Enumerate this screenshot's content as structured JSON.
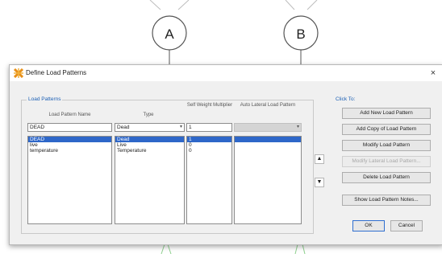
{
  "background": {
    "grid_bubbles": [
      {
        "label": "A"
      },
      {
        "label": "B"
      }
    ],
    "line_color": "#b8b8b8",
    "accent_green": "#8fd18f"
  },
  "dialog": {
    "title": "Define Load Patterns",
    "title_icon": "app-icon",
    "close_glyph": "×",
    "load_patterns_group": {
      "label": "Load Patterns",
      "columns": {
        "name": "Load Pattern Name",
        "type": "Type",
        "self_weight": "Self Weight Multiplier",
        "auto_lateral": "Auto Lateral Load Pattern"
      },
      "edit_row": {
        "name": "DEAD",
        "type": "Dead",
        "self_weight": "1",
        "auto_lateral": ""
      },
      "rows": [
        {
          "name": "DEAD",
          "type": "Dead",
          "self_weight": "1",
          "auto_lateral": "",
          "selected": true
        },
        {
          "name": "live",
          "type": "Live",
          "self_weight": "0",
          "auto_lateral": "",
          "selected": false
        },
        {
          "name": "temperature",
          "type": "Temperature",
          "self_weight": "0",
          "auto_lateral": "",
          "selected": false
        }
      ]
    },
    "move_up_icon": "arrow-up-icon",
    "move_down_icon": "arrow-down-icon",
    "click_to_label": "Click To:",
    "buttons": {
      "add_new": "Add New Load Pattern",
      "add_copy": "Add Copy of Load Pattern",
      "modify": "Modify Load Pattern",
      "modify_lateral": "Modify Lateral Load Pattern...",
      "delete": "Delete Load Pattern",
      "show_notes": "Show Load Pattern Notes...",
      "ok": "OK",
      "cancel": "Cancel"
    },
    "colors": {
      "selection": "#2e67c9",
      "group_label": "#1b5fb5",
      "dialog_bg": "#f0f0f0"
    }
  }
}
